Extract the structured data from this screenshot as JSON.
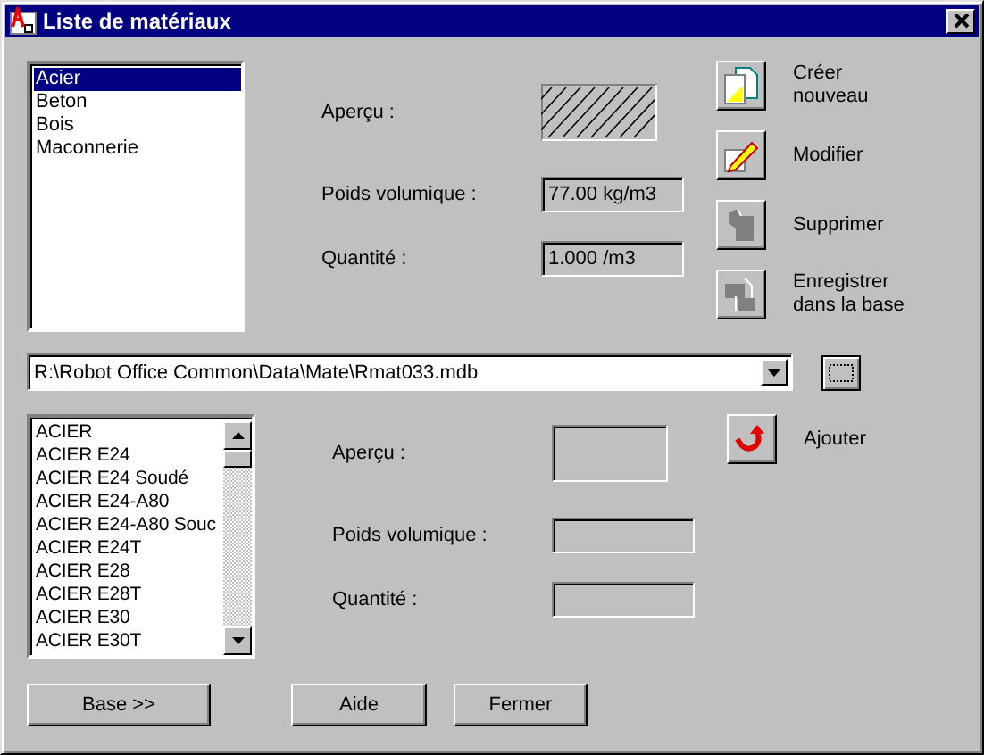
{
  "window": {
    "title": "Liste de matériaux"
  },
  "materials": [
    {
      "label": "Acier",
      "selected": true
    },
    {
      "label": "Beton",
      "selected": false
    },
    {
      "label": "Bois",
      "selected": false
    },
    {
      "label": "Maconnerie",
      "selected": false
    }
  ],
  "current": {
    "preview_label": "Aperçu :",
    "density_label": "Poids volumique :",
    "density": "77.00 kg/m3",
    "quantity_label": "Quantité :",
    "quantity": "1.000 /m3"
  },
  "actions": [
    {
      "kind": "new",
      "label": "Créer nouveau",
      "disabled": false
    },
    {
      "kind": "edit",
      "label": "Modifier",
      "disabled": false
    },
    {
      "kind": "delete",
      "label": "Supprimer",
      "disabled": true
    },
    {
      "kind": "save",
      "label": "Enregistrer dans la base",
      "disabled": true
    }
  ],
  "database": {
    "path": "R:\\Robot Office Common\\Data\\Mate\\Rmat033.mdb"
  },
  "db_materials": [
    "ACIER",
    "ACIER E24",
    "ACIER E24 Soudé",
    "ACIER E24-A80",
    "ACIER E24-A80 Souc",
    "ACIER E24T",
    "ACIER E28",
    "ACIER E28T",
    "ACIER E30",
    "ACIER E30T"
  ],
  "db_details": {
    "preview_label": "Aperçu :",
    "density_label": "Poids volumique :",
    "quantity_label": "Quantité :"
  },
  "add_button": {
    "label": "Ajouter"
  },
  "buttons": [
    "Base >>",
    "Aide",
    "Fermer"
  ]
}
